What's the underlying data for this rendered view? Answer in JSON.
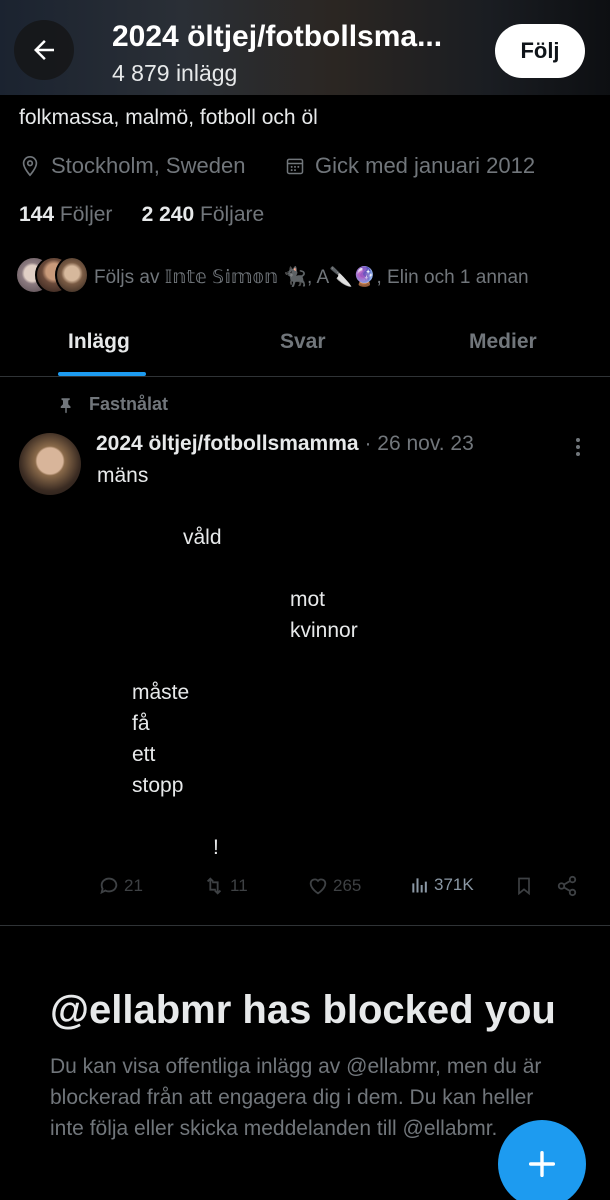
{
  "header": {
    "name": "2024 öltjej/fotbollsma...",
    "post_count": "4 879 inlägg",
    "follow_label": "Följ"
  },
  "profile": {
    "bio": "folkmassa, malmö, fotboll och öl",
    "location": "Stockholm, Sweden",
    "joined": "Gick med januari 2012",
    "following_count": "144",
    "following_label": "Följer",
    "followers_count": "2 240",
    "followers_label": "Följare",
    "followed_by": "Följs av 𝕀𝕟𝕥𝕖 𝕊𝕚𝕞𝕠𝕟 🐈‍⬛, A🔪🔮, Elin och 1 annan"
  },
  "tabs": [
    {
      "label": "Inlägg",
      "active": true
    },
    {
      "label": "Svar",
      "active": false
    },
    {
      "label": "Medier",
      "active": false
    }
  ],
  "post": {
    "pinned_label": "Fastnålat",
    "author": "2024 öltjej/fotbollsmamma",
    "date": "· 26 nov. 23",
    "lines": [
      "mäns",
      "våld",
      "mot",
      "kvinnor",
      "måste",
      "få",
      "ett",
      "stopp",
      "!"
    ],
    "actions": {
      "replies": "21",
      "reposts": "11",
      "likes": "265",
      "views": "371K"
    }
  },
  "blocked": {
    "title": "@ellabmr has blocked you",
    "text": "Du kan visa offentliga inlägg av @ellabmr, men du är blockerad från att engagera dig i dem. Du kan heller inte följa eller skicka meddelanden till @ellabmr."
  },
  "colors": {
    "accent": "#1d9bf0",
    "text": "#e7e9ea",
    "secondary": "#71767b",
    "background": "#000000"
  },
  "icons": [
    "back-arrow-icon",
    "location-pin-icon",
    "calendar-icon",
    "pin-icon",
    "more-vertical-icon",
    "reply-icon",
    "repost-icon",
    "like-icon",
    "views-icon",
    "bookmark-icon",
    "share-icon",
    "plus-icon"
  ]
}
